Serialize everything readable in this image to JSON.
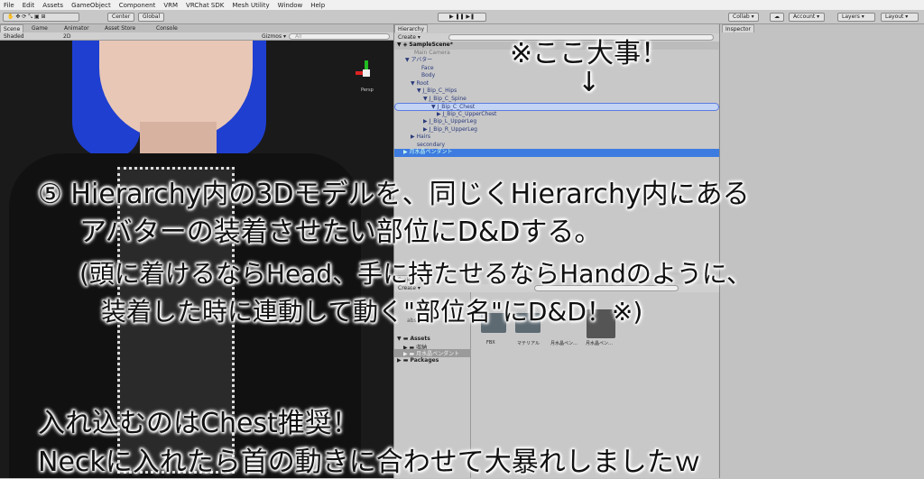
{
  "menu": [
    "File",
    "Edit",
    "Assets",
    "GameObject",
    "Component",
    "VRM",
    "VRChat SDK",
    "Mesh Utility",
    "Window",
    "Help"
  ],
  "toolbar": {
    "center": "Center",
    "global": "Global",
    "collab": "Collab ▾",
    "account": "Account ▾",
    "layers": "Layers ▾",
    "layout": "Layout ▾"
  },
  "scene_tabs": [
    "Scene",
    "Game",
    "Animator",
    "Asset Store",
    "Console"
  ],
  "scene_toolbar": {
    "shading": "Shaded",
    "mode_2d": "2D",
    "gizmos": "Gizmos ▾",
    "search_placeholder": "All",
    "persp": "Persp"
  },
  "hierarchy": {
    "tab": "Hierarchy",
    "create": "Create ▾",
    "scene": "SampleScene*",
    "items": [
      "Main Camera",
      "アバター",
      "Face",
      "Body",
      "Root",
      "J_Bip_C_Hips",
      "J_Bip_C_Spine",
      "J_Bip_C_Chest",
      "J_Bip_C_UpperChest",
      "J_Bip_L_UpperLeg",
      "J_Bip_R_UpperLeg",
      "Hairs",
      "secondary",
      "月水晶ペンダント"
    ]
  },
  "project": {
    "tab": "Project",
    "create": "Create ▾",
    "tree": [
      "Assets",
      "収納",
      "月水晶ペンダント",
      "Packages"
    ],
    "favorites_partial": "abs",
    "files": [
      "FBX",
      "マテリアル",
      "月水晶ペン…",
      "月水晶ペン…"
    ]
  },
  "inspector": {
    "tab": "Inspector"
  },
  "captions": {
    "important": "※ここ大事！",
    "arrow": "↓",
    "line1": "⑤ Hierarchy内の3Dモデルを、同じくHierarchy内にある",
    "line2": "アバターの装着させたい部位にD&Dする。",
    "line3": "(頭に着けるならHead、手に持たせるならHandのように、",
    "line4": "装着した時に連動して動く\"部位名\"にD&D！※)",
    "line5": "入れ込むのはChest推奨！",
    "line6": "Neckに入れたら首の動きに合わせて大暴れしましたｗ"
  }
}
